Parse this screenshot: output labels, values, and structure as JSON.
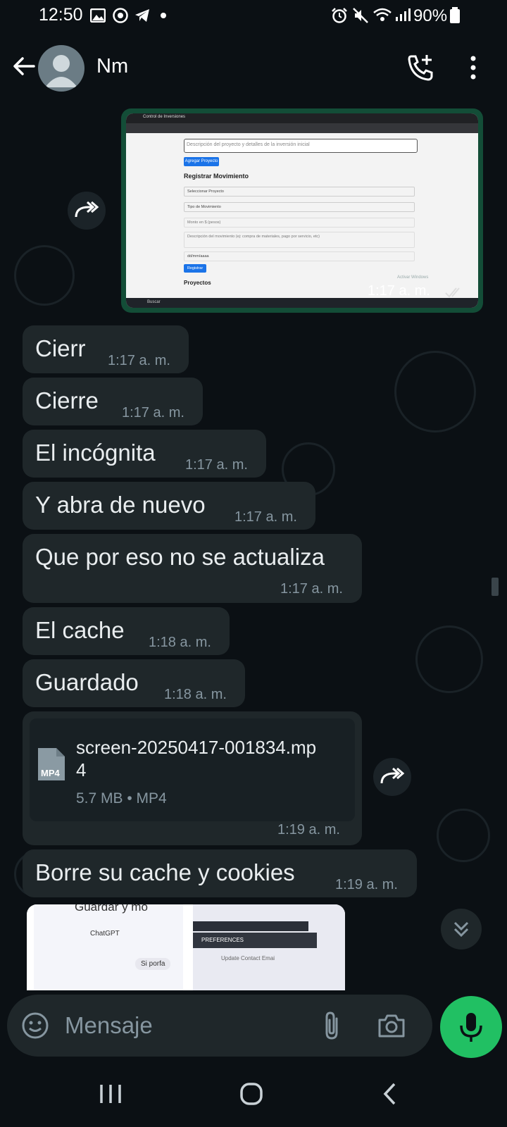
{
  "status_bar": {
    "time": "12:50",
    "battery": "90%",
    "icons": [
      "gallery-icon",
      "chrome-icon",
      "telegram-icon",
      "dot-icon",
      "alarm-icon",
      "mute-icon",
      "wifi-icon",
      "signal-icon",
      "battery-icon"
    ]
  },
  "header": {
    "contact_name": "Nm",
    "icons": [
      "back-arrow-icon",
      "avatar",
      "add-call-icon",
      "more-vert-icon"
    ]
  },
  "image_message": {
    "time": "1:17 a. m.",
    "screenshot_text": {
      "tab": "Control de Inversiones",
      "description_placeholder": "Descripción del proyecto y detalles de la inversión inicial",
      "add_project_button": "Agregar Proyecto",
      "heading_register": "Registrar Movimiento",
      "select_project": "Seleccionar Proyecto",
      "movement_type": "Tipo de Movimiento",
      "amount": "Monto en $ (pesos)",
      "movement_desc": "Descripción del movimiento (ej: compra de materiales, pago por servicio, etc)",
      "date": "dd/mm/aaaa",
      "register_button": "Registrar",
      "projects_heading": "Proyectos",
      "activate_windows": "Activar Windows",
      "search": "Buscar"
    }
  },
  "messages": [
    {
      "text": "Cierr",
      "time": "1:17 a. m."
    },
    {
      "text": "Cierre",
      "time": "1:17 a. m."
    },
    {
      "text": "El incógnita",
      "time": "1:17 a. m."
    },
    {
      "text": "Y abra de nuevo",
      "time": "1:17 a. m."
    },
    {
      "text": "Que por eso no se actualiza",
      "time": "1:17 a. m."
    },
    {
      "text": "El cache",
      "time": "1:18 a. m."
    },
    {
      "text": "Guardado",
      "time": "1:18 a. m."
    }
  ],
  "file_message": {
    "badge": "MP4",
    "filename_line1": "screen-20250417-001834.mp",
    "filename_line2": "4",
    "meta": "5.7 MB • MP4",
    "time": "1:19 a. m."
  },
  "last_message": {
    "text": "Borre su cache y cookies",
    "time": "1:19 a. m."
  },
  "preview_strip": {
    "left_title": "Guardar y mo",
    "left_app": "ChatGPT",
    "left_chip": "Si porfa",
    "right_section": "PREFERENCES",
    "right_item": "Update Contact Emai"
  },
  "input": {
    "placeholder": "Mensaje",
    "icons": [
      "emoji-icon",
      "attach-icon",
      "camera-icon",
      "mic-icon"
    ]
  },
  "accent_colors": {
    "mic_button": "#21c063",
    "image_border": "#134d37",
    "bubble": "#1f272a"
  }
}
